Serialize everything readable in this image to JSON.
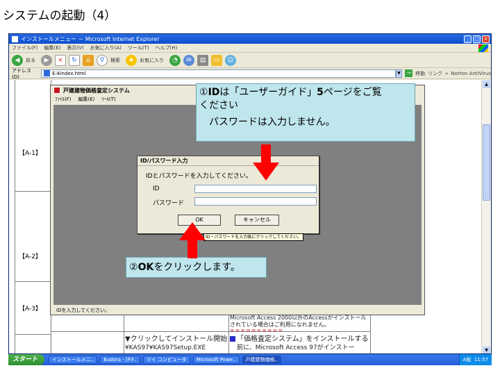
{
  "slide": {
    "title": "システムの起動（4）"
  },
  "ie": {
    "title": "インストールメニュー － Microsoft Internet Explorer",
    "menu": [
      "ファイル(F)",
      "編集(E)",
      "表示(V)",
      "お気に入り(A)",
      "ツール(T)",
      "ヘルプ(H)"
    ],
    "toolbar": {
      "back": "戻る",
      "search": "検索",
      "favorites": "お気に入り"
    },
    "address_label": "アドレス(D)",
    "address_value": "E:¥index.html",
    "go_label": "移動",
    "links_label": "リンク",
    "norton_label": "Norton AntiVirus"
  },
  "page": {
    "row_labels": [
      "【A-1】",
      "【A-2】",
      "【A-3】"
    ],
    "access_note_1": "Microsoft Access 2000以外のAccessがインストール",
    "access_note_2": "されている場合はご利用になれません。",
    "access_note_eq": "==========",
    "install_link": "▼クリックしてインストール開始",
    "install_path": "¥KAS97¥KAS97Setup.EXE",
    "info_1": "「価格査定システム」をインストールする",
    "info_2": "前に、Microsoft Access 97がインストー"
  },
  "app": {
    "title": "戸建建物価格査定システム",
    "menu": [
      "ﾌｧｲﾙ(F)",
      "編集(E)",
      "ﾂｰﾙ(T)"
    ],
    "status": "IDを入力してください。"
  },
  "dialog": {
    "title": "ID/パスワード入力",
    "prompt": "IDとパスワードを入力してください。",
    "id_label": "ID",
    "password_label": "パスワード",
    "ok_label": "OK",
    "cancel_label": "キャンセル",
    "tooltip": "ID・パスワードを入力後にクリックしてください。"
  },
  "callouts": {
    "c1_num": "①",
    "c1_bold1": "ID",
    "c1_text1": "は「ユーザーガイド」",
    "c1_bold2": "5",
    "c1_text2": "ページをご覧",
    "c1_text3": "ください",
    "c1_text4": "パスワードは入力しません。",
    "c2_num": "②",
    "c2_bold": "OK",
    "c2_text": "をクリックします。"
  },
  "taskbar": {
    "start": "スタート",
    "items": [
      "インストールメニ..",
      "Eudora - [P.F..",
      "マイ コンピュータ",
      "Microsoft Powe..",
      "戸建建物価格.."
    ],
    "tray_text": "A般",
    "clock": "11:57"
  },
  "colors": {
    "callout_bg": "#bfe6ec",
    "arrow_red": "#ff0000",
    "canvas_gray": "#808080"
  }
}
